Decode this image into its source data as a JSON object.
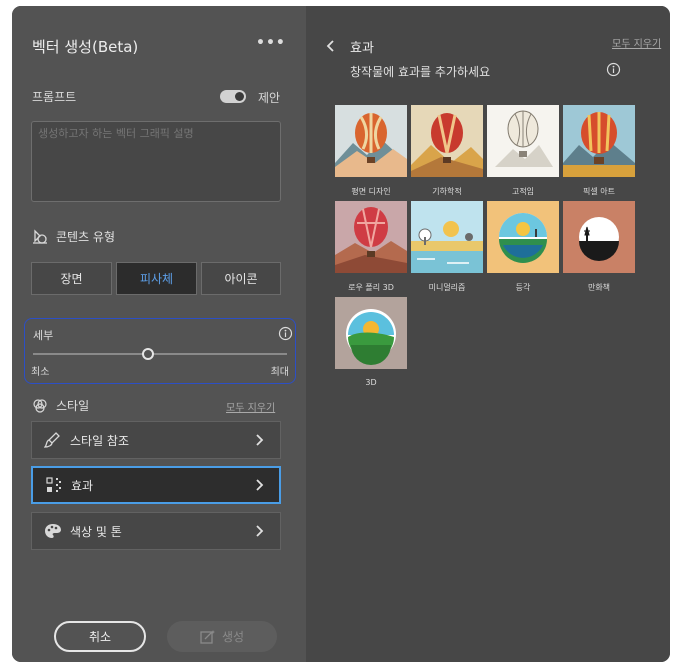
{
  "left_panel": {
    "title": "벡터 생성(Beta)",
    "more_label": "•••",
    "prompt": {
      "label": "프롬프트",
      "toggle_label": "제안",
      "toggle_on": true,
      "placeholder": "생성하고자 하는 벡터 그래픽 설명",
      "value": ""
    },
    "content_type": {
      "label": "콘텐츠 유형",
      "options": [
        "장면",
        "피사체",
        "아이콘"
      ],
      "selected": "피사체"
    },
    "detail": {
      "label": "세부",
      "min_label": "최소",
      "max_label": "최대",
      "value_fraction": 0.5
    },
    "style": {
      "label": "스타일",
      "clear_label": "모두 지우기",
      "rows": [
        {
          "label": "스타일 참조",
          "icon": "brush-icon"
        },
        {
          "label": "효과",
          "icon": "effects-icon"
        },
        {
          "label": "색상 및 톤",
          "icon": "palette-icon"
        }
      ]
    },
    "footer": {
      "cancel_label": "취소",
      "generate_label": "생성"
    }
  },
  "right_panel": {
    "title": "효과",
    "subtitle": "창작물에 효과를 추가하세요",
    "clear_label": "모두 지우기",
    "effects": [
      {
        "label": "평면 디자인"
      },
      {
        "label": "기하학적"
      },
      {
        "label": "고적임"
      },
      {
        "label": "픽셀 아트"
      },
      {
        "label": "로우 폴리 3D"
      },
      {
        "label": "미니멀리즘"
      },
      {
        "label": "등각"
      },
      {
        "label": "만화책"
      },
      {
        "label": "3D"
      }
    ]
  },
  "colors": {
    "accent_blue": "#4a9de6",
    "selected_text": "#5d9fe8",
    "focus_border": "#2c4fc6"
  }
}
